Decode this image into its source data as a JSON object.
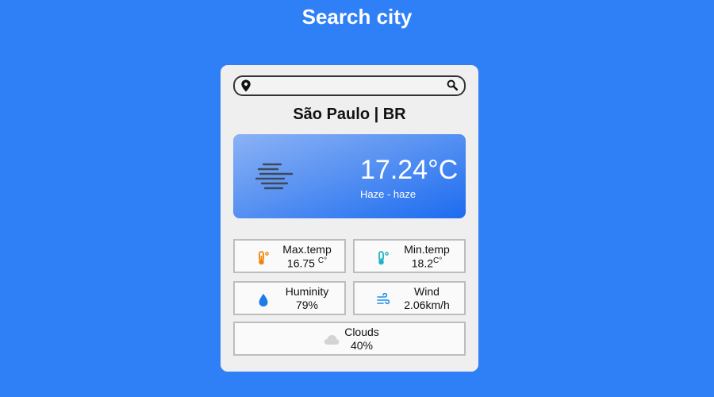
{
  "header": {
    "title": "Search city"
  },
  "search": {
    "placeholder": "",
    "value": ""
  },
  "location": {
    "city": "São Paulo | BR"
  },
  "current": {
    "temperature": "17.24",
    "unit": "°C",
    "description": "Haze - haze",
    "icon": "haze-icon"
  },
  "details": {
    "max_temp": {
      "label": "Max.temp",
      "value": "16.75 ",
      "unit": "C°",
      "icon": "thermometer-hot-icon",
      "color": "#f2840b"
    },
    "min_temp": {
      "label": "Min.temp",
      "value": "18.2",
      "unit": "C°",
      "icon": "thermometer-cold-icon",
      "color": "#21b3c4"
    },
    "humidity": {
      "label": "Huminity",
      "value": "79%",
      "icon": "water-drop-icon",
      "color": "#1e7be8"
    },
    "wind": {
      "label": "Wind",
      "value": "2.06km/h",
      "icon": "wind-icon",
      "color": "#1e90e8"
    },
    "clouds": {
      "label": "Clouds",
      "value": "40%",
      "icon": "cloud-icon",
      "color": "#cfcfcf"
    }
  }
}
